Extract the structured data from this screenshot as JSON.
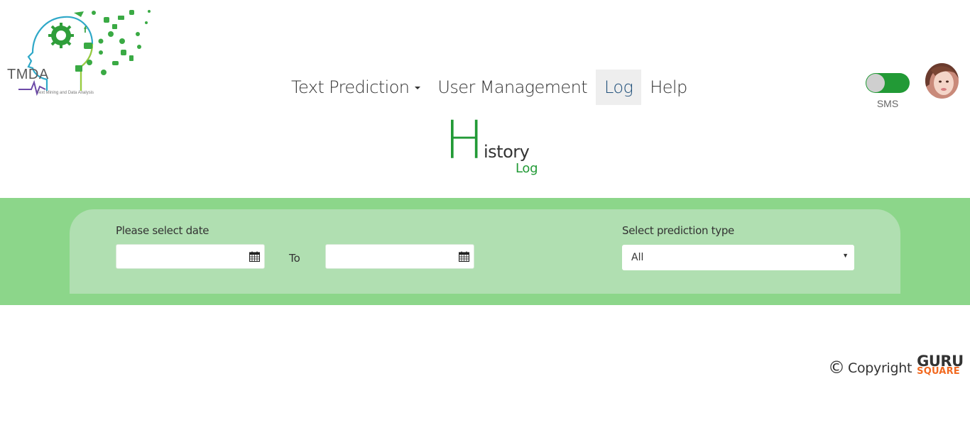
{
  "header": {
    "logo": {
      "text": "TMDA",
      "subtitle": "Text Mining and Data Analysis",
      "icons": [
        "twitter-icon",
        "facebook-icon",
        "skype-icon",
        "linkedin-icon",
        "whatsapp-icon",
        "youtube-icon",
        "messenger-icon",
        "instagram-icon",
        "home-icon",
        "wifi-icon",
        "gear-icon"
      ]
    },
    "nav": [
      {
        "label": "Text Prediction",
        "has_dropdown": true,
        "active": false
      },
      {
        "label": "User Management",
        "has_dropdown": false,
        "active": false
      },
      {
        "label": "Log",
        "has_dropdown": false,
        "active": true
      },
      {
        "label": "Help",
        "has_dropdown": false,
        "active": false
      }
    ],
    "sms_toggle": {
      "label": "SMS",
      "on": true
    },
    "avatar": "user-avatar"
  },
  "title": {
    "initial": "H",
    "rest": "istory",
    "subtitle": "Log"
  },
  "filters": {
    "date_label": "Please select date",
    "date_from": {
      "value": "",
      "icon": "calendar-icon"
    },
    "to_label": "To",
    "date_to": {
      "value": "",
      "icon": "calendar-icon"
    },
    "type_label": "Select prediction type",
    "type_value": "All"
  },
  "footer": {
    "copyright_symbol": "©",
    "copyright_text": "Copyright",
    "brand_top": "GURU",
    "brand_bottom": "SQUARE"
  },
  "colors": {
    "accent_green": "#229a36",
    "band_green": "#8cd68a",
    "panel_green": "#b0dfb1",
    "active_nav_bg": "#eeeeee",
    "active_nav_text": "#23527c",
    "brand_orange": "#f26a21"
  }
}
